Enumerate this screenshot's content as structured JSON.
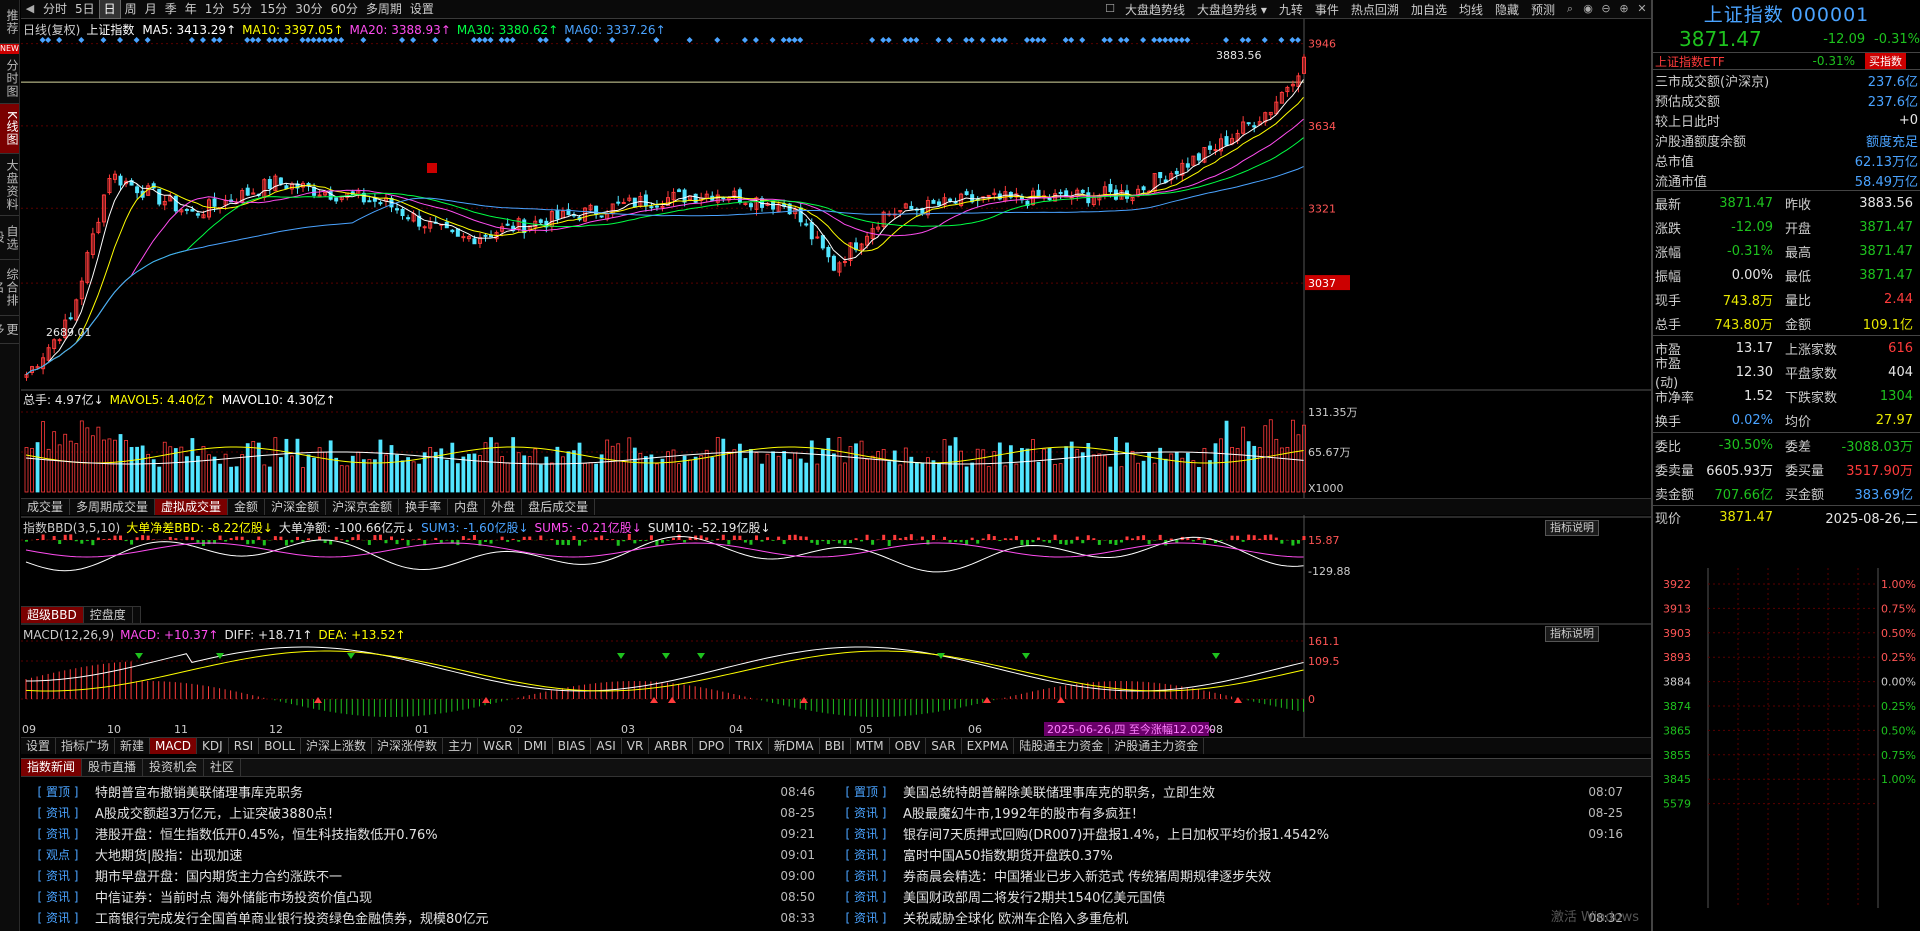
{
  "left_tabs": [
    {
      "label": "推荐",
      "active": false
    },
    {
      "label": "分时图",
      "active": false
    },
    {
      "label": "K线图",
      "active": true
    },
    {
      "label": "大盘资料",
      "active": false
    },
    {
      "label": "自选股",
      "active": false
    },
    {
      "label": "综合排名",
      "active": false
    },
    {
      "label": "更多",
      "active": false
    }
  ],
  "new_badge": "NEW",
  "toolbar": {
    "periods": [
      "分时",
      "5日",
      "日",
      "周",
      "月",
      "季",
      "年",
      "1分",
      "5分",
      "15分",
      "30分",
      "60分",
      "多周期",
      "设置"
    ],
    "selected_period": "日",
    "tools": [
      "大盘趋势线",
      "大盘趋势线 ▾",
      "九转",
      "事件",
      "热点回溯",
      "加自选",
      "均线",
      "隐藏",
      "预测"
    ]
  },
  "main_chart": {
    "name": "日线(复权)",
    "security": "上证指数",
    "ma": [
      {
        "label": "MA5: 3413.29↑",
        "color": "#ffffff"
      },
      {
        "label": "MA10: 3397.05↑",
        "color": "#ffff00"
      },
      {
        "label": "MA20: 3388.93↑",
        "color": "#ff4df0"
      },
      {
        "label": "MA30: 3380.62↑",
        "color": "#00ff44"
      },
      {
        "label": "MA60: 3337.26↑",
        "color": "#4aa3ff"
      }
    ],
    "y_ticks": [
      "3946",
      "3634",
      "3321",
      "3037"
    ],
    "y_hidden": "3009",
    "high_label": "3883.56",
    "low_label": "2689.01",
    "colors": {
      "up": "#ff3b3b",
      "down": "#52e5ff",
      "grid": "#5a0000"
    }
  },
  "volume_panel": {
    "legend": [
      {
        "label": "总手: 4.97亿↓",
        "color": "#e6e6e6"
      },
      {
        "label": "MAVOL5: 4.40亿↑",
        "color": "#ffff00"
      },
      {
        "label": "MAVOL10: 4.30亿↑",
        "color": "#ffffff"
      }
    ],
    "y_ticks": [
      "131.35万",
      "65.67万",
      "X1000"
    ],
    "tabs": [
      "成交量",
      "多周期成交量",
      "虚拟成交量",
      "金额",
      "沪深金额",
      "沪深京金额",
      "换手率",
      "内盘",
      "外盘",
      "盘后成交量"
    ],
    "selected_tab": "虚拟成交量"
  },
  "bbd_panel": {
    "legend": [
      {
        "label": "指数BBD(3,5,10)",
        "color": "#cccccc"
      },
      {
        "label": "大单净差BBD: -8.22亿股↓",
        "color": "#ffff00"
      },
      {
        "label": "大单净额: -100.66亿元↓",
        "color": "#e6e6e6"
      },
      {
        "label": "SUM3: -1.60亿股↓",
        "color": "#4aa3ff"
      },
      {
        "label": "SUM5: -0.21亿股↓",
        "color": "#ff4df0"
      },
      {
        "label": "SUM10: -52.19亿股↓",
        "color": "#e6e6e6"
      }
    ],
    "y_ticks": [
      "15.87",
      "-129.88"
    ],
    "help": "指标说明",
    "tabs": [
      "超级BBD",
      "控盘度"
    ],
    "selected_tab": "超级BBD"
  },
  "macd_panel": {
    "legend": [
      {
        "label": "MACD(12,26,9)",
        "color": "#cccccc"
      },
      {
        "label": "MACD: +10.37↑",
        "color": "#ff4df0"
      },
      {
        "label": "DIFF: +18.71↑",
        "color": "#e6e6e6"
      },
      {
        "label": "DEA: +13.52↑",
        "color": "#ffff00"
      }
    ],
    "y_ticks": [
      "161.1",
      "109.5",
      "0"
    ],
    "help": "指标说明"
  },
  "x_axis": {
    "labels": [
      "09",
      "10",
      "11",
      "12",
      "01",
      "02",
      "03",
      "04",
      "05",
      "06",
      "08"
    ],
    "cursor_note": "2025-06-26,四 至今涨幅12.02%"
  },
  "indicator_tabs": [
    "设置",
    "指标广场",
    "新建",
    "MACD",
    "KDJ",
    "RSI",
    "BOLL",
    "沪深上涨数",
    "沪深涨停数",
    "主力",
    "W&R",
    "DMI",
    "BIAS",
    "ASI",
    "VR",
    "ARBR",
    "DPO",
    "TRIX",
    "新DMA",
    "BBI",
    "MTM",
    "OBV",
    "SAR",
    "EXPMA",
    "陆股通主力资金",
    "沪股通主力资金"
  ],
  "selected_indicator": "MACD",
  "news": {
    "tabs": [
      "指数新闻",
      "股市直播",
      "投资机会",
      "社区"
    ],
    "selected_tab": "指数新闻",
    "left": [
      {
        "tag": "[ 置顶 ]",
        "title": "特朗普宣布撤销美联储理事库克职务",
        "time": "08:46"
      },
      {
        "tag": "[ 资讯 ]",
        "title": "A股成交额超3万亿元，上证突破3880点！",
        "time": "08-25"
      },
      {
        "tag": "[ 资讯 ]",
        "title": "港股开盘：恒生指数低开0.45%，恒生科技指数低开0.76%",
        "time": "09:21"
      },
      {
        "tag": "[ 观点 ]",
        "title": "大地期货|股指：出现加速",
        "time": "09:01"
      },
      {
        "tag": "[ 资讯 ]",
        "title": "期市早盘开盘：国内期货主力合约涨跌不一",
        "time": "09:00"
      },
      {
        "tag": "[ 资讯 ]",
        "title": "中信证券：当前时点 海外储能市场投资价值凸现",
        "time": "08:50"
      },
      {
        "tag": "[ 资讯 ]",
        "title": "工商银行完成发行全国首单商业银行投资绿色金融债券，规模80亿元",
        "time": "08:33"
      }
    ],
    "right": [
      {
        "tag": "[ 置顶 ]",
        "title": "美国总统特朗普解除美联储理事库克的职务，立即生效",
        "time": "08:07"
      },
      {
        "tag": "[ 资讯 ]",
        "title": "A股最魔幻牛市,1992年的股市有多疯狂！",
        "time": "08-25"
      },
      {
        "tag": "[ 资讯 ]",
        "title": "银存间7天质押式回购(DR007)开盘报1.4%，上日加权平均价报1.4542%",
        "time": "09:16"
      },
      {
        "tag": "[ 资讯 ]",
        "title": "富时中国A50指数期货开盘跌0.37%",
        "time": ""
      },
      {
        "tag": "[ 资讯 ]",
        "title": "券商晨会精选：中国猪业已步入新范式 传统猪周期规律逐步失效",
        "time": ""
      },
      {
        "tag": "[ 资讯 ]",
        "title": "美国财政部周二将发行2期共1540亿美元国债",
        "time": ""
      },
      {
        "tag": "[ 资讯 ]",
        "title": "关税威胁全球化 欧洲车企陷入多重危机",
        "time": "08:32"
      }
    ]
  },
  "quote": {
    "title": "上证指数 000001",
    "price": "3871.47",
    "change": "-12.09",
    "change_pct": "-0.31%",
    "etf_name": "上证指数ETF",
    "etf_pct": "-0.31%",
    "etf_button": "买指数",
    "info": [
      {
        "k": "三市成交额(沪深京)",
        "v": "237.6亿",
        "c": "b"
      },
      {
        "k": "预估成交额",
        "v": "237.6亿",
        "c": "b"
      },
      {
        "k": "较上日此时",
        "v": "+0",
        "c": "w"
      },
      {
        "k": "沪股通额度余额",
        "v": "额度充足",
        "c": "b"
      },
      {
        "k": "总市值",
        "v": "62.13万亿",
        "c": "b"
      },
      {
        "k": "流通市值",
        "v": "58.49万亿",
        "c": "b"
      }
    ],
    "pairs": [
      [
        "最新",
        "3871.47",
        "g",
        "昨收",
        "3883.56",
        "w"
      ],
      [
        "涨跌",
        "-12.09",
        "g",
        "开盘",
        "3871.47",
        "g"
      ],
      [
        "涨幅",
        "-0.31%",
        "g",
        "最高",
        "3871.47",
        "g"
      ],
      [
        "振幅",
        "0.00%",
        "w",
        "最低",
        "3871.47",
        "g"
      ],
      [
        "现手",
        "743.8万",
        "y",
        "量比",
        "2.44",
        "r"
      ],
      [
        "总手",
        "743.80万",
        "y",
        "金额",
        "109.1亿",
        "y"
      ]
    ],
    "pairs2": [
      [
        "市盈",
        "13.17",
        "w",
        "上涨家数",
        "616",
        "r"
      ],
      [
        "市盈(动)",
        "12.30",
        "w",
        "平盘家数",
        "404",
        "w"
      ],
      [
        "市净率",
        "1.52",
        "w",
        "下跌家数",
        "1304",
        "g"
      ],
      [
        "换手",
        "0.02%",
        "b",
        "均价",
        "27.97",
        "y"
      ]
    ],
    "order": [
      [
        "委比",
        "-30.50%",
        "g",
        "委差",
        "-3088.03万",
        "g"
      ],
      [
        "委卖量",
        "6605.93万",
        "w",
        "委买量",
        "3517.90万",
        "r"
      ],
      [
        "卖金额",
        "707.66亿",
        "g",
        "买金额",
        "383.69亿",
        "b"
      ]
    ],
    "now_label": "现价",
    "now_price": "3871.47",
    "date": "2025-08-26,二",
    "mini_y_left": [
      "3922",
      "3913",
      "3903",
      "3893",
      "3884",
      "3874",
      "3865",
      "3855",
      "3845",
      "5579"
    ],
    "mini_y_right": [
      "1.00%",
      "0.75%",
      "0.50%",
      "0.25%",
      "0.00%",
      "0.25%",
      "0.50%",
      "0.75%",
      "1.00%"
    ],
    "watermark": "激活 Windows"
  }
}
